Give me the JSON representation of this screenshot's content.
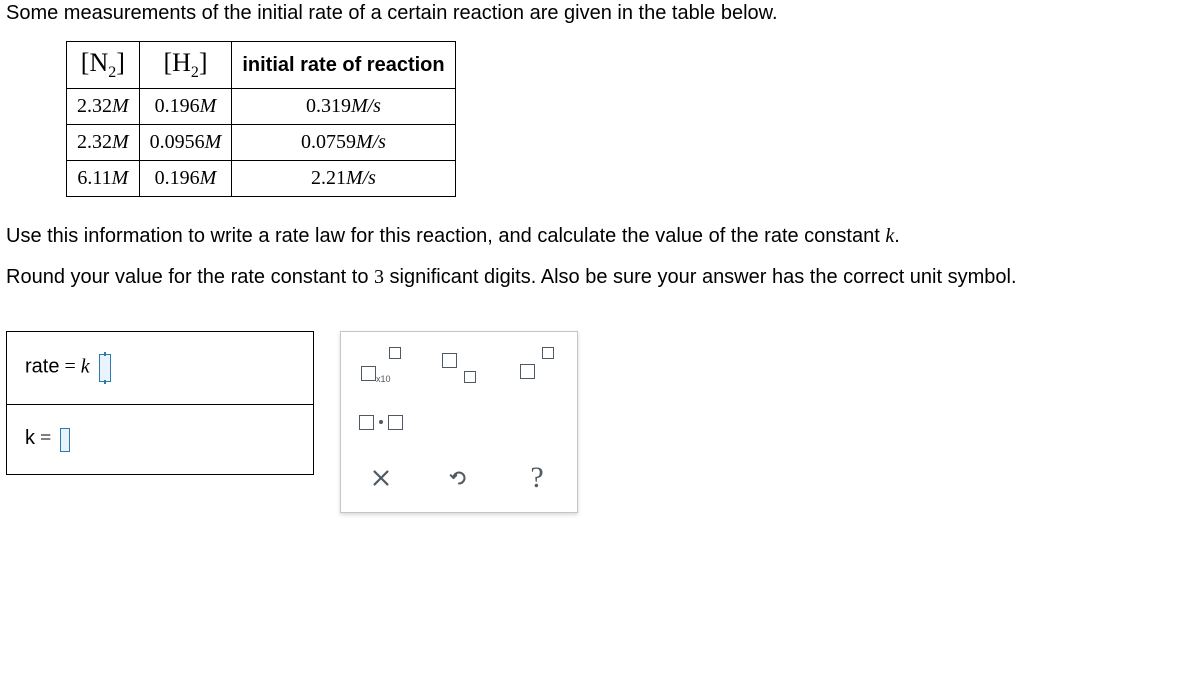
{
  "intro_text": "Some measurements of the initial rate of a certain reaction are given in the table below.",
  "table": {
    "headers": {
      "col1_species": "N",
      "col1_sub": "2",
      "col2_species": "H",
      "col2_sub": "2",
      "col3": "initial rate of reaction"
    },
    "rows": [
      {
        "n2": "2.32",
        "h2": "0.196",
        "rate": "0.319"
      },
      {
        "n2": "2.32",
        "h2": "0.0956",
        "rate": "0.0759"
      },
      {
        "n2": "6.11",
        "h2": "0.196",
        "rate": "2.21"
      }
    ],
    "unit_conc": "M",
    "unit_rate": "M/s"
  },
  "instruction_1a": "Use this information to write a rate law for this reaction, and calculate the value of the rate constant ",
  "instruction_1b": ".",
  "rate_constant_symbol": "k",
  "instruction_2a": "Round your value for the rate constant to ",
  "sigfigs": "3",
  "instruction_2b": " significant digits. Also be sure your answer has the correct unit symbol.",
  "answer_box": {
    "rate_label": "rate",
    "equals": " = ",
    "k_italic": "k",
    "k_label": "k"
  },
  "palette": {
    "x10": "x10",
    "clear_icon": "close-icon",
    "undo_icon": "undo-icon",
    "help_symbol": "?"
  },
  "chart_data": {
    "type": "table",
    "columns": [
      "[N2] (M)",
      "[H2] (M)",
      "initial rate (M/s)"
    ],
    "rows": [
      [
        2.32,
        0.196,
        0.319
      ],
      [
        2.32,
        0.0956,
        0.0759
      ],
      [
        6.11,
        0.196,
        2.21
      ]
    ]
  }
}
